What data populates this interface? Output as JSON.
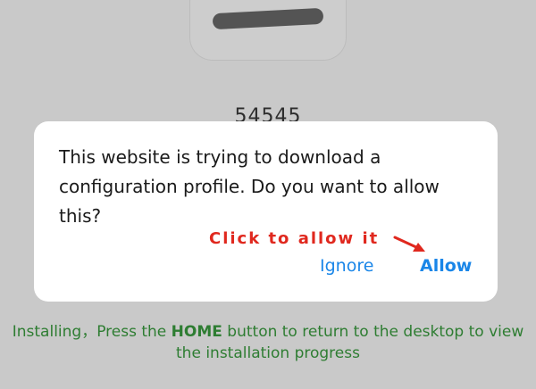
{
  "background": {
    "number": "54545"
  },
  "dialog": {
    "message": "This website is trying to download a configuration profile. Do you want to allow this?",
    "ignore_label": "Ignore",
    "allow_label": "Allow"
  },
  "annotation": {
    "hint": "Click to allow it",
    "color": "#e0281e"
  },
  "footer": {
    "part1": "Installing，Press the ",
    "emphasis": "HOME",
    "part2": " button to return to the desktop to view the installation progress"
  },
  "colors": {
    "button_blue": "#1a86e8",
    "footer_green": "#2e7d32",
    "overlay": "#c9c9c9"
  }
}
